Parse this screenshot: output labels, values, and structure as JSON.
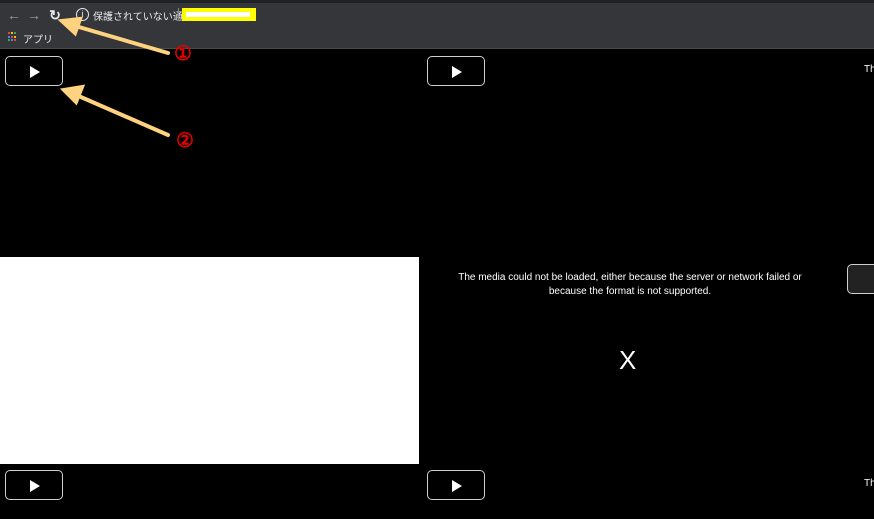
{
  "browser": {
    "back_icon": "arrow-left-icon",
    "forward_icon": "arrow-right-icon",
    "reload_icon": "reload-icon",
    "security_icon": "info-circle-icon",
    "security_text": "保護されていない通信",
    "url_highlight_color": "#ffff00",
    "bookmarks": {
      "apps_label": "アプリ",
      "apps_icon": "apps-grid-icon"
    }
  },
  "player": {
    "play_icon": "play-icon",
    "edge_text_top": "Th",
    "edge_text_bottom": "Th",
    "error_message": "The media could not be loaded, either because the server or network failed or because the format is not supported.",
    "error_symbol": "X"
  },
  "annotations": {
    "marker_1": "①",
    "marker_2": "②",
    "arrow_color": "#ffd27f",
    "marker_color": "#e00000"
  }
}
